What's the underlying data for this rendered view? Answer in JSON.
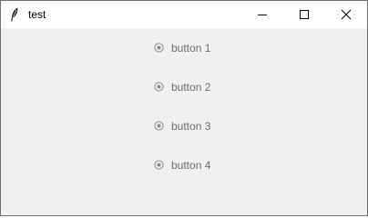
{
  "window": {
    "title": "test",
    "app_icon": "feather-icon",
    "controls": [
      "minimize-icon",
      "maximize-icon",
      "close-icon"
    ]
  },
  "radio_group": {
    "items": [
      {
        "label": "button 1",
        "selected": false
      },
      {
        "label": "button 2",
        "selected": false
      },
      {
        "label": "button 3",
        "selected": false
      },
      {
        "label": "button 4",
        "selected": false
      }
    ],
    "state": "disabled",
    "label_color": "#6d6d6d"
  },
  "colors": {
    "titlebar": "#ffffff",
    "client_bg": "#f0f0f0",
    "border": "#6f6f6f"
  }
}
